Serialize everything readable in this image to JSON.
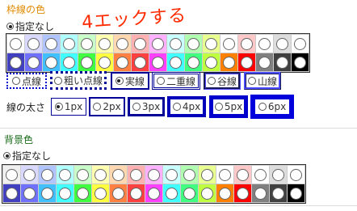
{
  "border_section": {
    "title": "枠線の色",
    "annotation": "4エックする",
    "none_label": "指定なし",
    "palette_row1": [
      "#ffffff",
      "#d9d9ff",
      "#b0c4ff",
      "#b0ffff",
      "#c8ffc8",
      "#ffffb0",
      "#ffd8b0",
      "#ffb0b0",
      "#ffb0ff",
      "#c8ffff",
      "#b0ffb0",
      "#e8ff90",
      "#ffffff",
      "#ffc8c8",
      "#ffffff",
      "#dddddd",
      "#ffffff"
    ],
    "palette_row2": [
      "#4040c0",
      "#7070ff",
      "#40c0ff",
      "#40ffff",
      "#40ff40",
      "#ffff40",
      "#ff8040",
      "#ff4040",
      "#ff40ff",
      "#40ffff",
      "#40ff80",
      "#c0ff40",
      "#ff8000",
      "#ff0000",
      "#808080",
      "#404040",
      "#000000"
    ]
  },
  "line_style": {
    "options": [
      {
        "label": "点線",
        "selected": false
      },
      {
        "label": "粗い点線",
        "selected": false
      },
      {
        "label": "実線",
        "selected": true
      },
      {
        "label": "二重線",
        "selected": false
      },
      {
        "label": "谷線",
        "selected": false
      },
      {
        "label": "山線",
        "selected": false
      }
    ]
  },
  "line_width": {
    "label": "線の太さ",
    "options": [
      {
        "label": "1px",
        "selected": true
      },
      {
        "label": "2px",
        "selected": false
      },
      {
        "label": "3px",
        "selected": false
      },
      {
        "label": "4px",
        "selected": false
      },
      {
        "label": "5px",
        "selected": false
      },
      {
        "label": "6px",
        "selected": false
      }
    ]
  },
  "background_section": {
    "title": "背景色",
    "none_label": "指定なし",
    "palette_row1": [
      "#f0f0f0",
      "#d9d9ff",
      "#b0c4ff",
      "#b0ffff",
      "#c8ffc8",
      "#ffffb0",
      "#ffd8b0",
      "#ffb0b0",
      "#ffb0ff",
      "#c8ffff",
      "#b0ffb0",
      "#e8ff90",
      "#ffffff",
      "#ffc8c8",
      "#ffffff",
      "#dddddd",
      "#ffffff"
    ],
    "palette_row2": [
      "#4040c0",
      "#7070ff",
      "#40c0ff",
      "#40ffff",
      "#40ff40",
      "#ffff40",
      "#ff8040",
      "#ff4040",
      "#ff40ff",
      "#40ffff",
      "#40ff80",
      "#c0ff40",
      "#ff8000",
      "#ff0000",
      "#808080",
      "#404040",
      "#000000"
    ]
  }
}
